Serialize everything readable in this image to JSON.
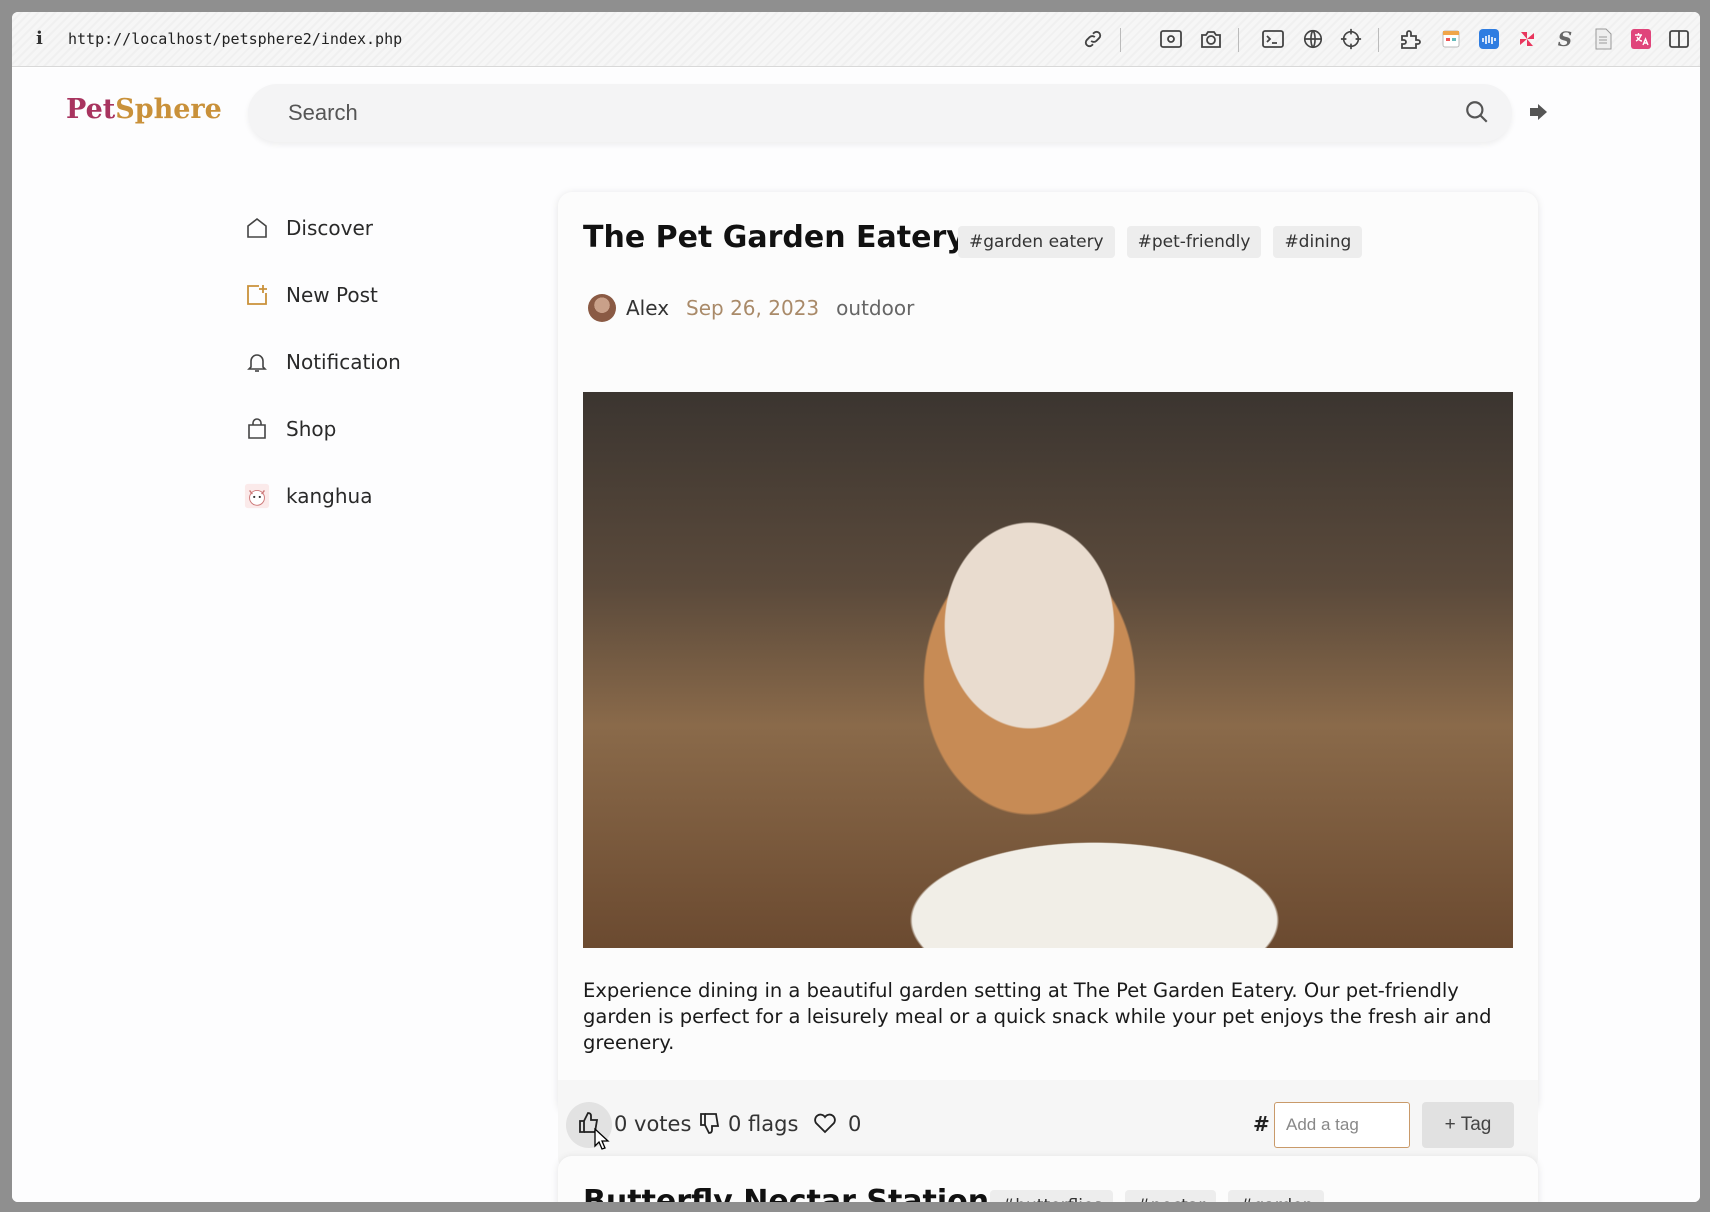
{
  "browser": {
    "info_symbol": "i",
    "url": "http://localhost/petsphere2/index.php",
    "toolbar_icons": [
      "link-icon",
      "screenshot-icon",
      "camera-icon",
      "terminal-icon",
      "globe-icon",
      "crosshair-icon",
      "extension-icon",
      "calendar-icon",
      "audio-icon",
      "pinwheel-icon",
      "s-icon",
      "document-icon",
      "translate-icon",
      "sidebar-icon"
    ]
  },
  "header": {
    "logo_part1": "Pet",
    "logo_part2": "Sphere",
    "search_placeholder": "Search"
  },
  "sidebar": {
    "items": [
      {
        "label": "Discover",
        "icon": "home-icon"
      },
      {
        "label": "New Post",
        "icon": "new-post-icon"
      },
      {
        "label": "Notification",
        "icon": "bell-icon"
      },
      {
        "label": "Shop",
        "icon": "shopping-bag-icon"
      },
      {
        "label": "kanghua",
        "icon": "profile-avatar-icon"
      }
    ]
  },
  "posts": [
    {
      "title": "The Pet Garden Eatery",
      "tags": [
        "#garden eatery",
        "#pet-friendly",
        "#dining"
      ],
      "author": "Alex",
      "date": "Sep 26, 2023",
      "category": "outdoor",
      "description": "Experience dining in a beautiful garden setting at The Pet Garden Eatery. Our pet-friendly garden is perfect for a leisurely meal or a quick snack while your pet enjoys the fresh air and greenery.",
      "votes_label": "0 votes",
      "flags_label": "0 flags",
      "likes": "0",
      "hash_symbol": "#",
      "tag_input_placeholder": "Add a tag",
      "add_tag_label": "+ Tag"
    },
    {
      "title": "Butterfly Nectar Station",
      "tags": [
        "#butterflies",
        "#nectar",
        "#garden"
      ]
    }
  ],
  "colors": {
    "logo_pet": "#a8345f",
    "logo_sphere": "#c9913a",
    "date": "#a98a69",
    "new_post_icon": "#c9913a",
    "tag_input_border": "#c99a6a"
  }
}
